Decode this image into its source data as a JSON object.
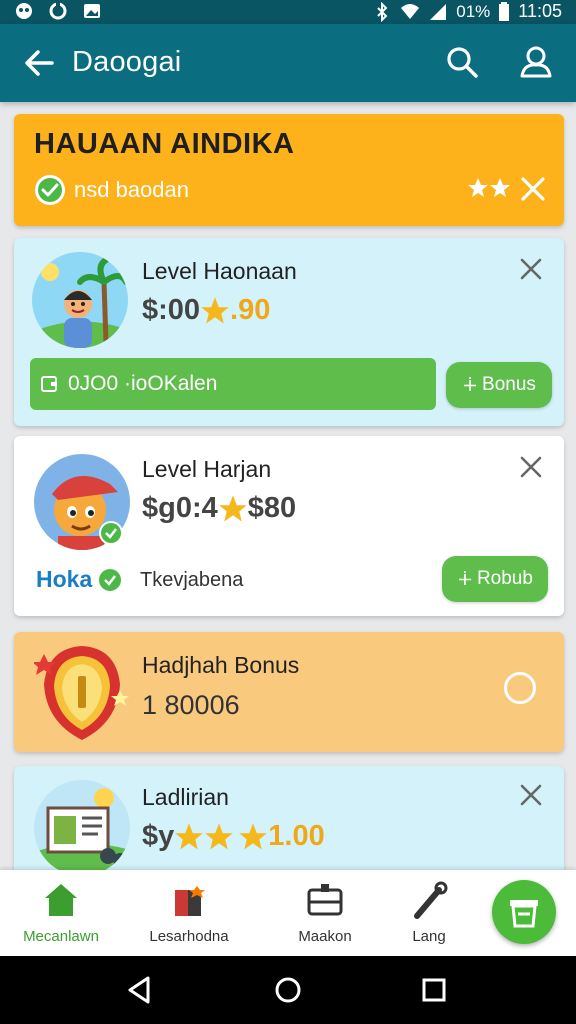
{
  "status_bar": {
    "battery": "01%",
    "time": "11:05"
  },
  "app_bar": {
    "title": "Daoogai"
  },
  "banner": {
    "title": "HAUAAN AINDIKA",
    "subtitle": "nsd baodan"
  },
  "cards": [
    {
      "title": "Level Haonaan",
      "value_prefix": "$:00",
      "value_suffix": ".90",
      "progress_text": "0JO0 ·ioOKalen",
      "button_label": "Bonus"
    },
    {
      "title": "Level Harjan",
      "value_prefix": "$g0:4",
      "value_suffix": "$80",
      "brand": "Hoka",
      "meta": "Tkevjabena",
      "button_label": "Robub"
    },
    {
      "title": "Hadjhah Bonus",
      "value": "1 80006"
    },
    {
      "title": "Ladlirian",
      "value_prefix": "$y",
      "value_suffix": "1.00"
    }
  ],
  "bottom_nav": [
    {
      "label": "Mecanlawn",
      "icon": "home-icon",
      "active": true
    },
    {
      "label": "Lesarhodna",
      "icon": "store-icon",
      "active": false
    },
    {
      "label": "Maakon",
      "icon": "camera-icon",
      "active": false
    },
    {
      "label": "Lang",
      "icon": "wrench-icon",
      "active": false
    }
  ],
  "colors": {
    "appbar": "#0b6d80",
    "banner": "#fdb21b",
    "accent_green": "#5fbd4c",
    "card_blue": "#d4f2fa",
    "card_orange": "#f9c97e"
  }
}
